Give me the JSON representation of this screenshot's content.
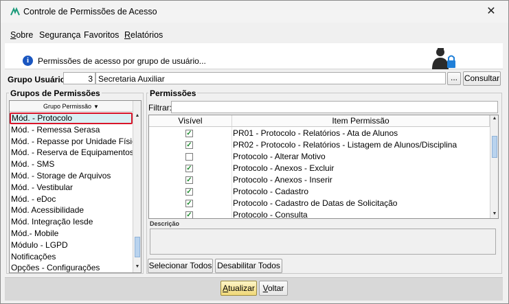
{
  "window": {
    "title": "Controle de Permissões de Acesso",
    "close_glyph": "✕"
  },
  "menu": [
    {
      "accel": "S",
      "rest": "obre"
    },
    {
      "accel": "",
      "rest": "Segurança"
    },
    {
      "accel": "",
      "rest": "Favoritos"
    },
    {
      "accel": "R",
      "rest": "elatórios"
    }
  ],
  "banner": {
    "text": "Permissões de acesso por grupo de usuário...",
    "info_glyph": "i",
    "image_icon": "user-lock-icon"
  },
  "grupo_usuario": {
    "label": "Grupo Usuário:",
    "id": "3",
    "name": "Secretaria Auxiliar",
    "lookup_label": "...",
    "consultar_label": "Consultar"
  },
  "grupos": {
    "legend": "Grupos de Permissões",
    "column_header": "Grupo Permissão",
    "items": [
      "Mód. - Protocolo",
      "Mód. - Remessa Serasa",
      "Mód. - Repasse por Unidade Física",
      "Mód. - Reserva de Equipamentos",
      "Mód. - SMS",
      "Mód. - Storage de Arquivos",
      "Mód. - Vestibular",
      "Mód. - eDoc",
      "Mód. Acessibilidade",
      "Mód. Integração Iesde",
      "Mód.- Mobile",
      "Módulo - LGPD",
      "Notificações",
      "Opções - Configurações"
    ],
    "selected_index": 0
  },
  "permissoes": {
    "legend": "Permissões",
    "filter_label": "Filtrar:",
    "filter_value": "",
    "columns": [
      "Visível",
      "Item Permissão"
    ],
    "rows": [
      {
        "visible": true,
        "item": "PR01 - Protocolo - Relatórios - Ata de Alunos"
      },
      {
        "visible": true,
        "item": "PR02 - Protocolo - Relatórios - Listagem de Alunos/Disciplina"
      },
      {
        "visible": false,
        "item": "Protocolo - Alterar Motivo"
      },
      {
        "visible": true,
        "item": "Protocolo - Anexos - Excluir"
      },
      {
        "visible": true,
        "item": "Protocolo - Anexos - Inserir"
      },
      {
        "visible": true,
        "item": "Protocolo - Cadastro"
      },
      {
        "visible": true,
        "item": "Protocolo - Cadastro de Datas de Solicitação"
      },
      {
        "visible": true,
        "item": "Protocolo - Consulta"
      }
    ],
    "check_glyph": "✓",
    "description_label": "Descrição",
    "description_value": "",
    "select_all_label": "Selecionar Todos",
    "disable_all_label": "Desabilitar Todos"
  },
  "footer": {
    "update_accel": "A",
    "update_rest": "tualizar",
    "back_accel": "V",
    "back_rest": "oltar"
  },
  "colors": {
    "selection_border": "#d8152a",
    "selection_fill": "#d9f0f4",
    "check": "#1d8a2e",
    "primary_button": "#f0d878"
  }
}
